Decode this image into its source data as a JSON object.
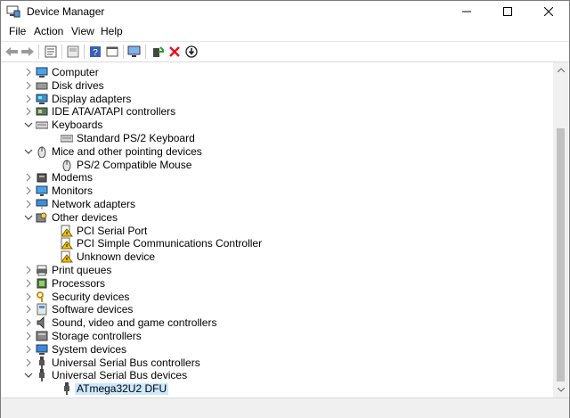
{
  "window": {
    "title": "Device Manager"
  },
  "menu": [
    "File",
    "Action",
    "View",
    "Help"
  ],
  "toolbar": [
    "back-icon",
    "forward-icon",
    "properties-icon",
    "show-hide-icon",
    "help-icon",
    "view-icon",
    "monitor-scan-icon",
    "update-driver-icon",
    "uninstall-icon",
    "disable-icon"
  ],
  "tree": [
    {
      "label": "Computer",
      "level": 1,
      "expanded": false,
      "icon": "computer-icon"
    },
    {
      "label": "Disk drives",
      "level": 1,
      "expanded": false,
      "icon": "disk-icon"
    },
    {
      "label": "Display adapters",
      "level": 1,
      "expanded": false,
      "icon": "display-icon"
    },
    {
      "label": "IDE ATA/ATAPI controllers",
      "level": 1,
      "expanded": false,
      "icon": "ide-icon"
    },
    {
      "label": "Keyboards",
      "level": 1,
      "expanded": true,
      "icon": "keyboard-icon"
    },
    {
      "label": "Standard PS/2 Keyboard",
      "level": 2,
      "icon": "keyboard-icon"
    },
    {
      "label": "Mice and other pointing devices",
      "level": 1,
      "expanded": true,
      "icon": "mouse-icon"
    },
    {
      "label": "PS/2 Compatible Mouse",
      "level": 2,
      "icon": "mouse-icon"
    },
    {
      "label": "Modems",
      "level": 1,
      "expanded": false,
      "icon": "modem-icon"
    },
    {
      "label": "Monitors",
      "level": 1,
      "expanded": false,
      "icon": "monitor-icon"
    },
    {
      "label": "Network adapters",
      "level": 1,
      "expanded": false,
      "icon": "network-icon"
    },
    {
      "label": "Other devices",
      "level": 1,
      "expanded": true,
      "icon": "other-devices-icon"
    },
    {
      "label": "PCI Serial Port",
      "level": 2,
      "icon": "warning-device-icon"
    },
    {
      "label": "PCI Simple Communications Controller",
      "level": 2,
      "icon": "warning-device-icon"
    },
    {
      "label": "Unknown device",
      "level": 2,
      "icon": "warning-device-icon"
    },
    {
      "label": "Print queues",
      "level": 1,
      "expanded": false,
      "icon": "printer-icon"
    },
    {
      "label": "Processors",
      "level": 1,
      "expanded": false,
      "icon": "processor-icon"
    },
    {
      "label": "Security devices",
      "level": 1,
      "expanded": false,
      "icon": "security-icon"
    },
    {
      "label": "Software devices",
      "level": 1,
      "expanded": false,
      "icon": "software-icon"
    },
    {
      "label": "Sound, video and game controllers",
      "level": 1,
      "expanded": false,
      "icon": "sound-icon"
    },
    {
      "label": "Storage controllers",
      "level": 1,
      "expanded": false,
      "icon": "storage-icon"
    },
    {
      "label": "System devices",
      "level": 1,
      "expanded": false,
      "icon": "system-icon"
    },
    {
      "label": "Universal Serial Bus controllers",
      "level": 1,
      "expanded": false,
      "icon": "usb-icon"
    },
    {
      "label": "Universal Serial Bus devices",
      "level": 1,
      "expanded": true,
      "icon": "usb-icon"
    },
    {
      "label": "ATmega32U2 DFU",
      "level": 2,
      "icon": "usb-icon",
      "selected": true
    }
  ],
  "colors": {
    "selection": "#cce8ff",
    "accent": "#1e73be",
    "error": "#e81123"
  }
}
